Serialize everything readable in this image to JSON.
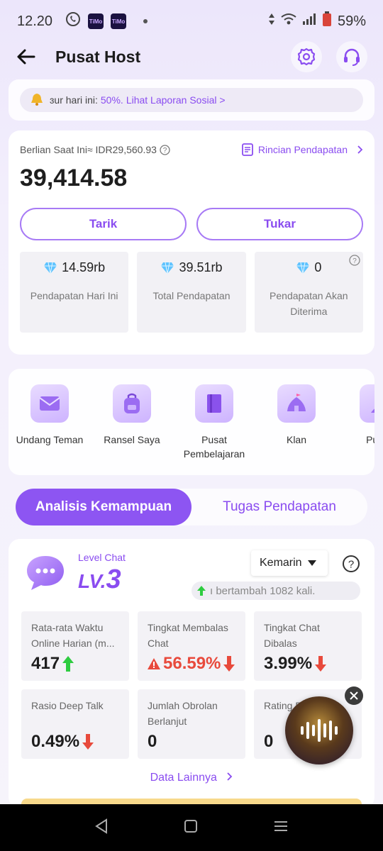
{
  "status_bar": {
    "time": "12.20",
    "app_badge": "TiMo",
    "battery": "59%"
  },
  "header": {
    "title": "Pusat Host"
  },
  "notice": {
    "text": "ɜur hari ini:",
    "percent": "50%.",
    "link": "Lihat Laporan Sosial >"
  },
  "balance": {
    "label": "Berlian Saat Ini≈ IDR29,560.93",
    "detail_link": "Rincian Pendapatan",
    "amount": "39,414.58",
    "withdraw_label": "Tarik",
    "exchange_label": "Tukar",
    "stats": [
      {
        "value": "14.59rb",
        "label": "Pendapatan Hari Ini"
      },
      {
        "value": "39.51rb",
        "label": "Total Pendapatan"
      },
      {
        "value": "0",
        "label": "Pendapatan Akan Diterima"
      }
    ]
  },
  "tools": [
    {
      "label": "Undang Teman",
      "icon": "mail-icon"
    },
    {
      "label": "Ransel Saya",
      "icon": "backpack-icon"
    },
    {
      "label": "Pusat Pembelajaran",
      "icon": "book-icon"
    },
    {
      "label": "Klan",
      "icon": "tent-icon"
    },
    {
      "label": "Pusat",
      "icon": "person-icon"
    }
  ],
  "tabs": {
    "active": "Analisis Kemampuan",
    "inactive": "Tugas Pendapatan"
  },
  "ability": {
    "level_label": "Level Chat",
    "level_prefix": "LV.",
    "level_value": "3",
    "period": "Kemarin",
    "marquee": "ı bertambah 1082 kali.",
    "metrics": [
      {
        "label": "Rata-rata Waktu Online Harian (m...",
        "value": "417",
        "trend": "up"
      },
      {
        "label": "Tingkat Membalas Chat",
        "value": "56.59%",
        "trend": "down",
        "warning": true
      },
      {
        "label": "Tingkat Chat Dibalas",
        "value": "3.99%",
        "trend": "down"
      },
      {
        "label": "Rasio Deep Talk",
        "value": "0.49%",
        "trend": "down"
      },
      {
        "label": "Jumlah Obrolan Berlanjut",
        "value": "0"
      },
      {
        "label": "Rating P... Chat",
        "value": "0"
      }
    ],
    "more_link": "Data Lainnya"
  },
  "colors": {
    "accent": "#8a4cf0",
    "up": "#2ecc40",
    "down": "#e84a3c"
  }
}
